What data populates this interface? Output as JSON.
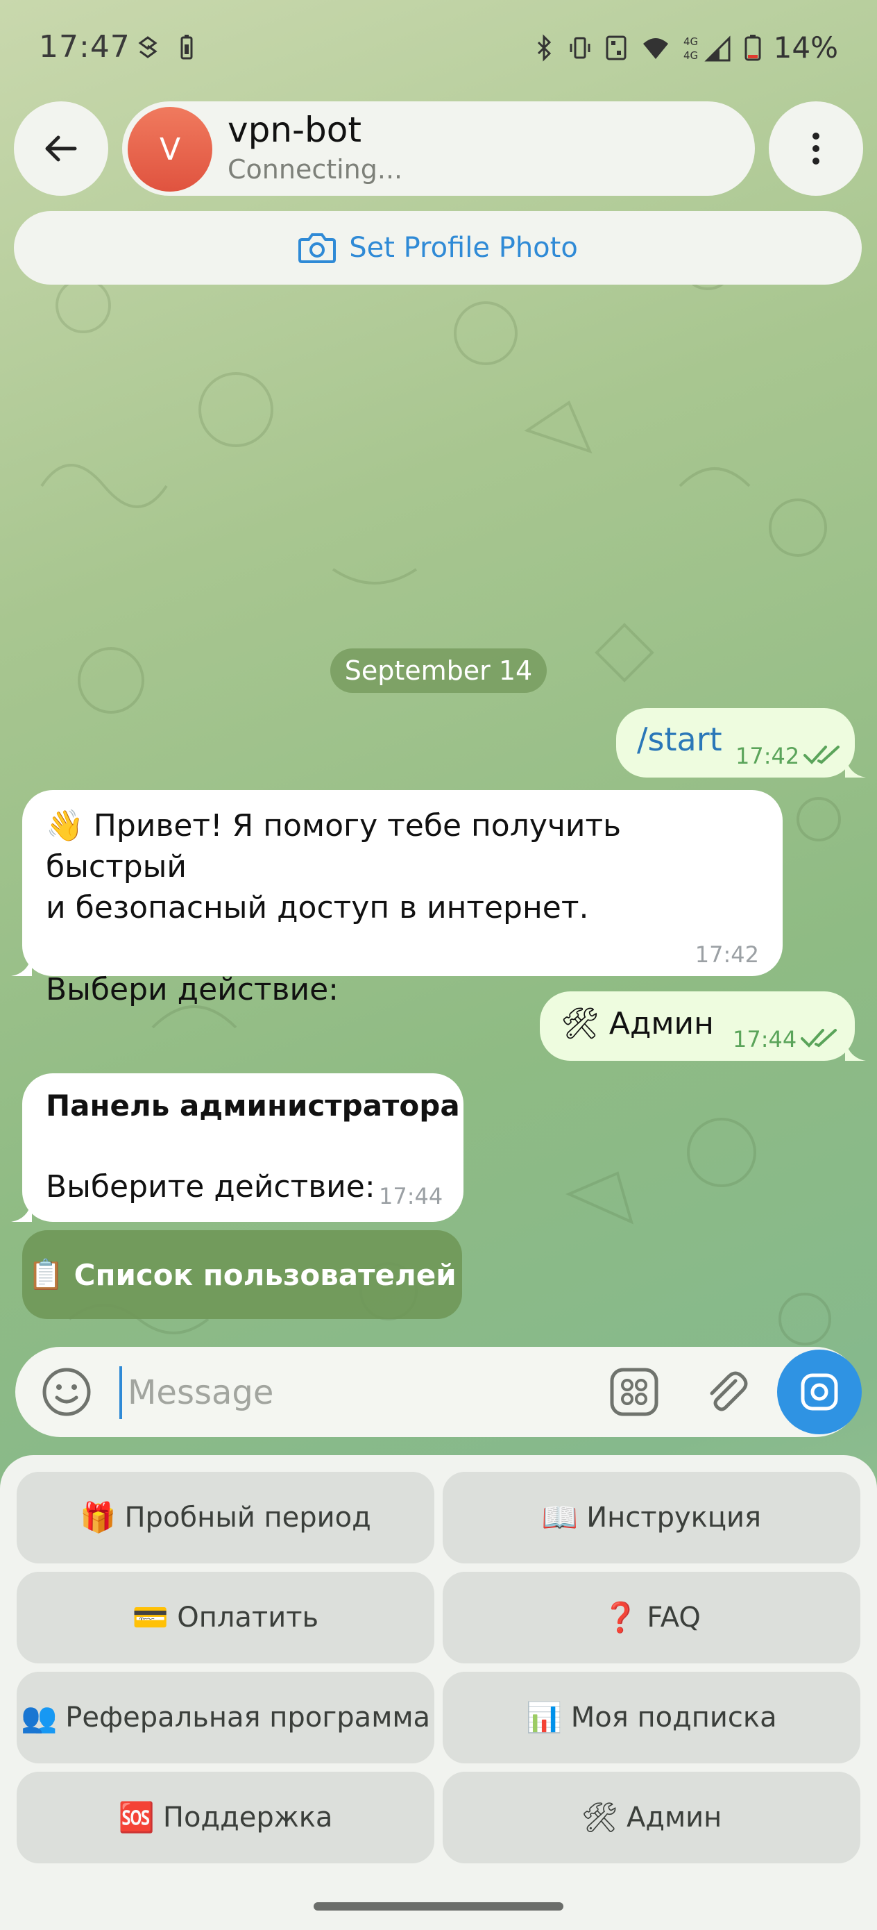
{
  "status_bar": {
    "time": "17:47",
    "battery_text": "14%",
    "network": "4G",
    "icons": [
      "sync-icon",
      "battery-saver-icon",
      "bluetooth-icon",
      "vibrate-icon",
      "nfc-icon",
      "wifi-icon",
      "signal-4g-icon",
      "battery-low-icon"
    ]
  },
  "header": {
    "avatar_letter": "V",
    "chat_name": "vpn-bot",
    "chat_status": "Connecting...",
    "set_photo_label": "Set Profile Photo"
  },
  "chat": {
    "date": "September 14",
    "messages": [
      {
        "id": "start",
        "direction": "out",
        "text": "/start",
        "time": "17:42",
        "read": true
      },
      {
        "id": "hello",
        "direction": "in",
        "text": "👋 Привет! Я помогу тебе получить быстрый\nи безопасный доступ в интернет.\n\nВыбери действие:",
        "time": "17:42"
      },
      {
        "id": "admin",
        "direction": "out",
        "text": "🛠 Админ",
        "time": "17:44",
        "read": true
      },
      {
        "id": "panel",
        "direction": "in",
        "title": "Панель администратора",
        "text": "Выберите действие:",
        "time": "17:44"
      }
    ],
    "inline_button": {
      "emoji": "📋",
      "label": "Список пользователей"
    }
  },
  "composer": {
    "placeholder": "Message"
  },
  "keyboard": {
    "buttons": [
      {
        "emoji": "🎁",
        "label": "Пробный период"
      },
      {
        "emoji": "📖",
        "label": "Инструкция"
      },
      {
        "emoji": "💳",
        "label": "Оплатить"
      },
      {
        "emoji": "❓",
        "label": "FAQ"
      },
      {
        "emoji": "👥",
        "label": "Реферальная программа"
      },
      {
        "emoji": "📊",
        "label": "Моя подписка"
      },
      {
        "emoji": "🆘",
        "label": "Поддержка"
      },
      {
        "emoji": "🛠",
        "label": "Админ"
      }
    ]
  },
  "colors": {
    "accent": "#2f93e3",
    "outgoing_bubble": "#eefcdf",
    "incoming_bubble": "#ffffff",
    "inline_button": "#6e9656",
    "read_check": "#5aa45a"
  }
}
